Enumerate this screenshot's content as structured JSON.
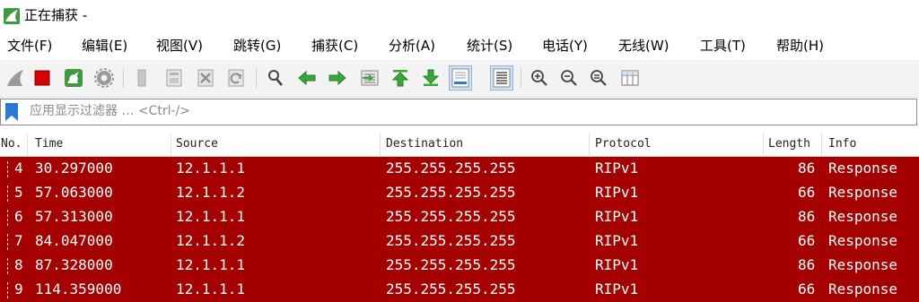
{
  "window": {
    "title": "正在捕获 -",
    "app_icon": "wireshark-fin-icon"
  },
  "menu": [
    {
      "label": "文件(F)"
    },
    {
      "label": "编辑(E)"
    },
    {
      "label": "视图(V)"
    },
    {
      "label": "跳转(G)"
    },
    {
      "label": "捕获(C)"
    },
    {
      "label": "分析(A)"
    },
    {
      "label": "统计(S)"
    },
    {
      "label": "电话(Y)"
    },
    {
      "label": "无线(W)"
    },
    {
      "label": "工具(T)"
    },
    {
      "label": "帮助(H)"
    }
  ],
  "toolbar": {
    "icons": [
      "start-capture-fin-icon",
      "stop-capture-icon",
      "restart-capture-icon",
      "capture-options-icon",
      "open-file-icon",
      "save-file-icon",
      "close-file-icon",
      "reload-file-icon",
      "find-packet-icon",
      "go-back-icon",
      "go-forward-icon",
      "go-to-packet-icon",
      "go-first-icon",
      "go-last-icon",
      "autoscroll-icon",
      "colorize-icon",
      "zoom-in-icon",
      "zoom-out-icon",
      "zoom-normal-icon",
      "resize-columns-icon"
    ]
  },
  "filter": {
    "placeholder": "应用显示过滤器 … <Ctrl-/>",
    "value": ""
  },
  "columns": {
    "no": "No.",
    "time": "Time",
    "source": "Source",
    "destination": "Destination",
    "protocol": "Protocol",
    "length": "Length",
    "info": "Info"
  },
  "colors": {
    "row_bg": "#a40000",
    "row_fg": "#ffffff",
    "accent": "#2a7ad5"
  },
  "packets": [
    {
      "no": "4",
      "time": "30.297000",
      "source": "12.1.1.1",
      "destination": "255.255.255.255",
      "protocol": "RIPv1",
      "length": "86",
      "info": "Response"
    },
    {
      "no": "5",
      "time": "57.063000",
      "source": "12.1.1.2",
      "destination": "255.255.255.255",
      "protocol": "RIPv1",
      "length": "66",
      "info": "Response"
    },
    {
      "no": "6",
      "time": "57.313000",
      "source": "12.1.1.1",
      "destination": "255.255.255.255",
      "protocol": "RIPv1",
      "length": "86",
      "info": "Response"
    },
    {
      "no": "7",
      "time": "84.047000",
      "source": "12.1.1.2",
      "destination": "255.255.255.255",
      "protocol": "RIPv1",
      "length": "66",
      "info": "Response"
    },
    {
      "no": "8",
      "time": "87.328000",
      "source": "12.1.1.1",
      "destination": "255.255.255.255",
      "protocol": "RIPv1",
      "length": "86",
      "info": "Response"
    },
    {
      "no": "9",
      "time": "114.359000",
      "source": "12.1.1.1",
      "destination": "255.255.255.255",
      "protocol": "RIPv1",
      "length": "66",
      "info": "Response"
    }
  ]
}
